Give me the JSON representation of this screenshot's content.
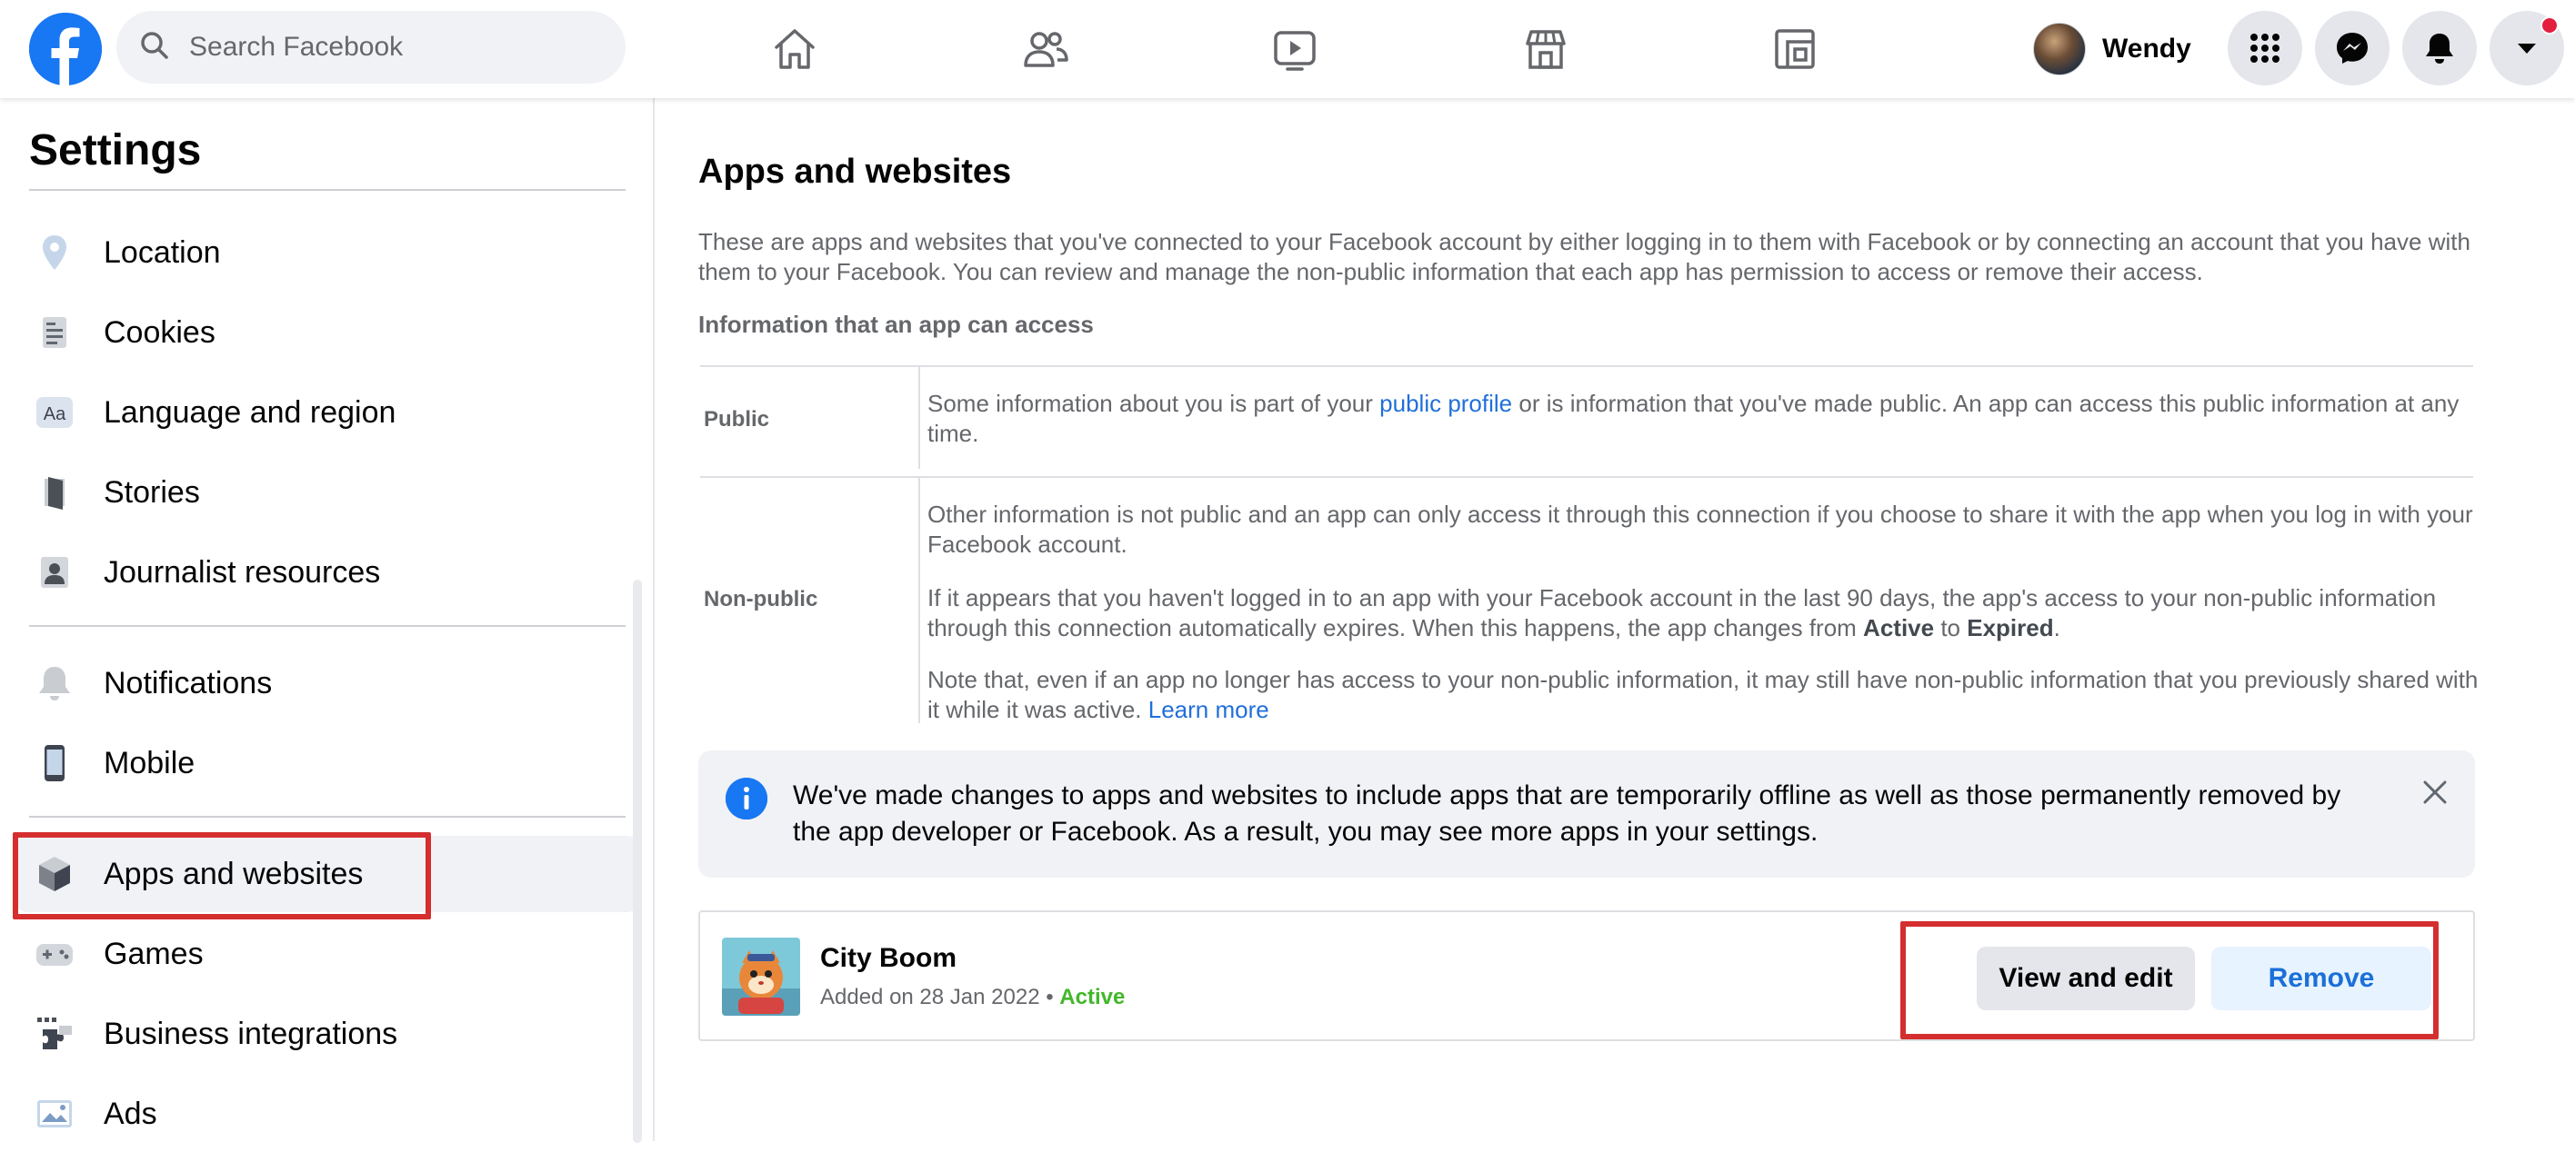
{
  "topbar": {
    "logo_icon": "facebook-logo-icon",
    "search_placeholder": "Search Facebook",
    "nav_icons": [
      "home-icon",
      "friends-icon",
      "watch-icon",
      "marketplace-icon",
      "gaming-icon"
    ],
    "profile_name": "Wendy",
    "right_buttons": [
      "menu-grid-icon",
      "messenger-icon",
      "notifications-bell-icon",
      "account-dropdown-icon"
    ],
    "notification_dot_color": "#e41e3f"
  },
  "sidebar": {
    "title": "Settings",
    "items": [
      {
        "label": "Location",
        "icon": "location-pin-icon"
      },
      {
        "label": "Cookies",
        "icon": "cookies-icon"
      },
      {
        "label": "Language and region",
        "icon": "language-icon"
      },
      {
        "label": "Stories",
        "icon": "stories-book-icon"
      },
      {
        "label": "Journalist resources",
        "icon": "journalist-icon"
      },
      {
        "label": "Notifications",
        "icon": "bell-icon"
      },
      {
        "label": "Mobile",
        "icon": "mobile-phone-icon"
      },
      {
        "label": "Apps and websites",
        "icon": "apps-cube-icon",
        "selected": true
      },
      {
        "label": "Games",
        "icon": "gamepad-icon"
      },
      {
        "label": "Business integrations",
        "icon": "business-integrations-icon"
      },
      {
        "label": "Ads",
        "icon": "ads-icon"
      }
    ],
    "language_icon_text": "Aa"
  },
  "main": {
    "title": "Apps and websites",
    "intro": "These are apps and websites that you've connected to your Facebook account by either logging in to them with Facebook or by connecting an account that you have with them to your Facebook. You can review and manage the non-public information that each app has permission to access or remove their access.",
    "info_heading": "Information that an app can access",
    "public": {
      "label": "Public",
      "text_before": "Some information about you is part of your ",
      "link": "public profile",
      "text_after": " or is information that you've made public. An app can access this public information at any time."
    },
    "nonpublic": {
      "label": "Non-public",
      "p1": "Other information is not public and an app can only access it through this connection if you choose to share it with the app when you log in with your Facebook account.",
      "p2_before": "If it appears that you haven't logged in to an app with your Facebook account in the last 90 days, the app's access to your non-public information through this connection automatically expires. When this happens, the app changes from ",
      "p2_active": "Active",
      "p2_to": " to ",
      "p2_expired": "Expired",
      "p2_end": ".",
      "p3_before": "Note that, even if an app no longer has access to your non-public information, it may still have non-public information that you previously shared with it while it was active. ",
      "p3_link": "Learn more"
    },
    "notice": {
      "text": "We've made changes to apps and websites to include apps that are temporarily offline as well as those permanently removed by the app developer or Facebook. As a result, you may see more apps in your settings.",
      "icon": "info-icon",
      "close_icon": "close-icon"
    },
    "app": {
      "name": "City Boom",
      "added": "Added on 28 Jan 2022",
      "separator": "•",
      "status": "Active",
      "view_edit_label": "View and edit",
      "remove_label": "Remove"
    }
  },
  "colors": {
    "brand_blue": "#1877f2",
    "link_blue": "#216fdb",
    "status_green": "#42b72a",
    "highlight_red": "#d42e2e",
    "muted_text": "#65676b"
  }
}
